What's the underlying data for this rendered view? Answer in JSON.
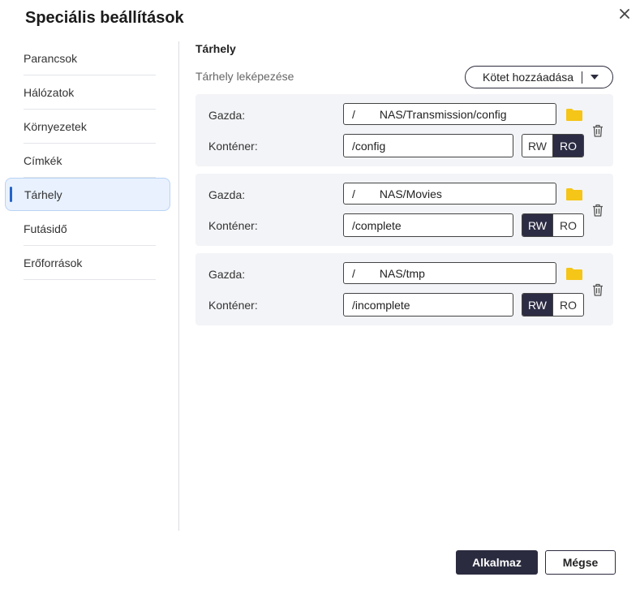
{
  "dialog": {
    "title": "Speciális beállítások"
  },
  "sidebar": {
    "items": [
      {
        "label": "Parancsok",
        "active": false
      },
      {
        "label": "Hálózatok",
        "active": false
      },
      {
        "label": "Környezetek",
        "active": false
      },
      {
        "label": "Címkék",
        "active": false
      },
      {
        "label": "Tárhely",
        "active": true
      },
      {
        "label": "Futásidő",
        "active": false
      },
      {
        "label": "Erőforrások",
        "active": false
      }
    ]
  },
  "storage": {
    "section_title": "Tárhely",
    "mapping_label": "Tárhely leképezése",
    "add_volume_label": "Kötet hozzáadása",
    "host_label": "Gazda:",
    "container_label": "Konténer:",
    "rw_label": "RW",
    "ro_label": "RO",
    "volumes": [
      {
        "host_prefix": "/",
        "host_path": "NAS/Transmission/config",
        "container_path": "/config",
        "mode": "RO"
      },
      {
        "host_prefix": "/",
        "host_path": "NAS/Movies",
        "container_path": "/complete",
        "mode": "RW"
      },
      {
        "host_prefix": "/",
        "host_path": "NAS/tmp",
        "container_path": "/incomplete",
        "mode": "RW"
      }
    ]
  },
  "footer": {
    "apply_label": "Alkalmaz",
    "cancel_label": "Mégse"
  },
  "colors": {
    "accent_dark": "#2b2b40",
    "active_bg": "#e8f1fd",
    "active_bar": "#2563c9",
    "folder": "#f5c518"
  },
  "icons": {
    "close": "close-icon",
    "folder": "folder-icon",
    "trash": "trash-icon",
    "caret": "caret-down-icon"
  }
}
